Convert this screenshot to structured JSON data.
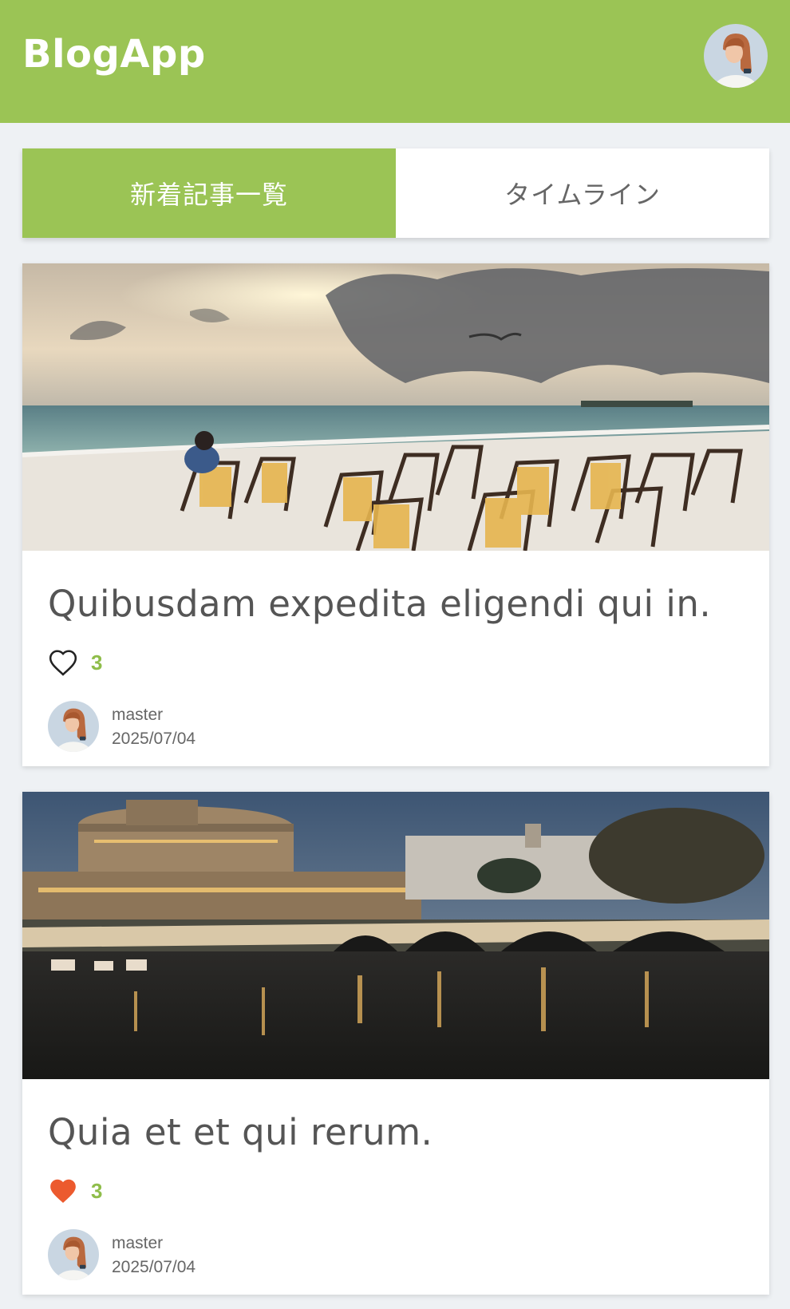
{
  "app": {
    "title": "BlogApp"
  },
  "tabs": [
    {
      "label": "新着記事一覧",
      "active": true
    },
    {
      "label": "タイムライン",
      "active": false
    }
  ],
  "posts": [
    {
      "title": "Quibusdam expedita eligendi qui in.",
      "likes": "3",
      "liked": false,
      "author": "master",
      "date": "2025/07/04",
      "image": "beach-sunset-deck-chairs"
    },
    {
      "title": "Quia et et qui rerum.",
      "likes": "3",
      "liked": true,
      "author": "master",
      "date": "2025/07/04",
      "image": "castle-bridge-river-night"
    }
  ],
  "colors": {
    "brand": "#9bc455",
    "like_active": "#ec5a2e",
    "like_count": "#8fbd4a",
    "background": "#eef1f4"
  }
}
